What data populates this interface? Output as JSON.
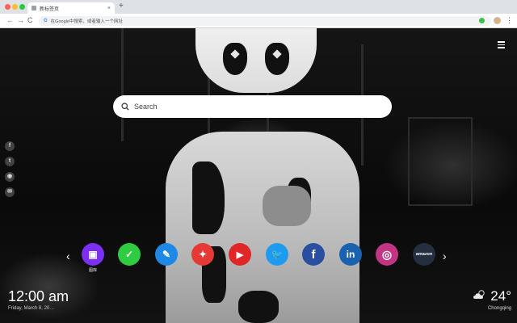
{
  "tab": {
    "title": "新标签页",
    "close": "×",
    "new_tab": "+"
  },
  "toolbar": {
    "back": "←",
    "forward": "→",
    "reload": "C",
    "engine_mark": "G",
    "address_placeholder": "在Google中搜索，或者输入一个网址",
    "menu": "⋮"
  },
  "search": {
    "placeholder": "Search"
  },
  "social": [
    {
      "name": "facebook-icon",
      "glyph": "f"
    },
    {
      "name": "twitter-icon",
      "glyph": "t"
    },
    {
      "name": "snapchat-icon",
      "glyph": "◉"
    },
    {
      "name": "wechat-icon",
      "glyph": "✉"
    }
  ],
  "quick_links": {
    "prev": "‹",
    "next": "›",
    "items": [
      {
        "name": "wallpaper",
        "label": "图库",
        "glyph": "▣",
        "color": "#7b2ff2"
      },
      {
        "name": "todo",
        "label": "",
        "glyph": "✓",
        "color": "#2ecc40"
      },
      {
        "name": "notes",
        "label": "",
        "glyph": "✎",
        "color": "#1e88e5"
      },
      {
        "name": "game",
        "label": "",
        "glyph": "✦",
        "color": "#e53935"
      },
      {
        "name": "youtube",
        "label": "",
        "glyph": "▶",
        "color": "#e02626"
      },
      {
        "name": "twitter",
        "label": "",
        "glyph": "🐦",
        "color": "#1d9bf0"
      },
      {
        "name": "facebook",
        "label": "",
        "glyph": "f",
        "color": "#2a4fa0"
      },
      {
        "name": "linkedin",
        "label": "",
        "glyph": "in",
        "color": "#1a62b0"
      },
      {
        "name": "instagram",
        "label": "",
        "glyph": "◎",
        "color": "#c13584"
      },
      {
        "name": "amazon",
        "label": "",
        "glyph": "amazon",
        "color": "#232f3e"
      }
    ]
  },
  "clock": {
    "time": "12:00 am",
    "date": "Friday, March 8, 20…"
  },
  "weather": {
    "icon": "cloud-sun-icon",
    "temp": "24°",
    "city": "Chongqing"
  }
}
